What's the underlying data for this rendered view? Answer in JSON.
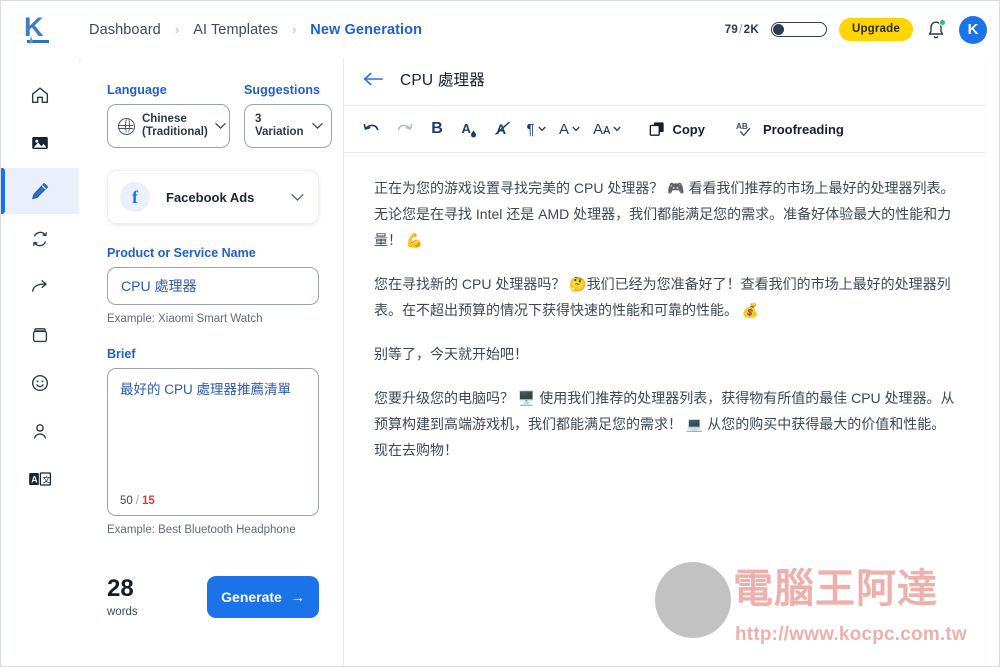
{
  "app": {
    "logo_letter": "K",
    "accent_blue": "#1a73e8",
    "link_blue": "#1f5fd0",
    "upgrade_yellow": "#ffd400",
    "limit_red": "#e23a3a"
  },
  "header": {
    "breadcrumb": [
      {
        "label": "Dashboard",
        "active": false
      },
      {
        "label": "AI Templates",
        "active": false
      },
      {
        "label": "New Generation",
        "active": true
      }
    ],
    "separator": "›",
    "credits_used": "79",
    "credits_slash": "/",
    "credits_total": "2K",
    "upgrade_label": "Upgrade",
    "bell_icon": "bell-icon",
    "avatar_letter": "K"
  },
  "sidebar": {
    "items": [
      {
        "name": "home",
        "icon": "home-icon",
        "active": false
      },
      {
        "name": "images",
        "icon": "image-icon",
        "active": false
      },
      {
        "name": "writer",
        "icon": "pencil-icon",
        "active": true
      },
      {
        "name": "rewrite",
        "icon": "sync-icon",
        "active": false
      },
      {
        "name": "share",
        "icon": "arrow-right-icon",
        "active": false
      },
      {
        "name": "archive",
        "icon": "box-icon",
        "active": false
      },
      {
        "name": "emoji",
        "icon": "smiley-icon",
        "active": false
      },
      {
        "name": "account",
        "icon": "person-icon",
        "active": false
      },
      {
        "name": "translate",
        "icon": "translate-icon",
        "active": false
      }
    ]
  },
  "form": {
    "language_label": "Language",
    "language_value": "Chinese\n(Traditional)",
    "language_line1": "Chinese",
    "language_line2": "(Traditional)",
    "suggestions_label": "Suggestions",
    "suggestions_line1": "3",
    "suggestions_line2": "Variation",
    "template_name": "Facebook Ads",
    "template_icon": "facebook-icon",
    "product_label": "Product or Service Name",
    "product_value": "CPU 處理器",
    "product_placeholder": "Product or Service Name",
    "product_hint": "Example: Xiaomi Smart Watch",
    "brief_label": "Brief",
    "brief_value": "最好的 CPU 處理器推薦清單",
    "brief_placeholder": "Brief",
    "brief_count": "50",
    "brief_sep": "/",
    "brief_limit": "15",
    "brief_hint": "Example: Best Bluetooth Headphone",
    "word_count": "28",
    "word_label": "words",
    "generate_label": "Generate",
    "generate_arrow": "→"
  },
  "editor": {
    "back_icon": "back-arrow-icon",
    "title": "CPU 處理器",
    "toolbar": [
      {
        "name": "undo",
        "glyph": "↶",
        "dim": false,
        "caret": false
      },
      {
        "name": "redo",
        "glyph": "↷",
        "dim": true,
        "caret": false
      },
      {
        "name": "bold",
        "glyph": "B",
        "dim": false,
        "caret": false
      },
      {
        "name": "text-color",
        "glyph": "A",
        "dim": false,
        "caret": false
      },
      {
        "name": "clear-format",
        "glyph": "A̶",
        "dim": false,
        "caret": false
      },
      {
        "name": "paragraph",
        "glyph": "¶",
        "dim": false,
        "caret": true
      },
      {
        "name": "font-family",
        "glyph": "A",
        "dim": false,
        "caret": true
      },
      {
        "name": "font-size",
        "glyph": "Aᴀ",
        "dim": false,
        "caret": true
      }
    ],
    "copy_label": "Copy",
    "copy_icon": "copy-icon",
    "proofread_label": "Proofreading",
    "proofread_icon": "ab-check-icon",
    "paragraphs": [
      "正在为您的游戏设置寻找完美的 CPU 处理器？ 🎮 看看我们推荐的市场上最好的处理器列表。无论您是在寻找 Intel 还是 AMD 处理器，我们都能满足您的需求。准备好体验最大的性能和力量！ 💪",
      "您在寻找新的 CPU 处理器吗？ 🤔我们已经为您准备好了！查看我们的市场上最好的处理器列表。在不超出预算的情况下获得快速的性能和可靠的性能。 💰",
      "别等了，今天就开始吧！",
      "您要升级您的电脑吗？ 🖥️ 使用我们推荐的处理器列表，获得物有所值的最佳 CPU 处理器。从预算构建到高端游戏机，我们都能满足您的需求！ 💻 从您的购买中获得最大的价值和性能。现在去购物！"
    ]
  },
  "watermark": {
    "text_cn": "電腦王阿達",
    "url": "http://www.kocpc.com.tw"
  }
}
